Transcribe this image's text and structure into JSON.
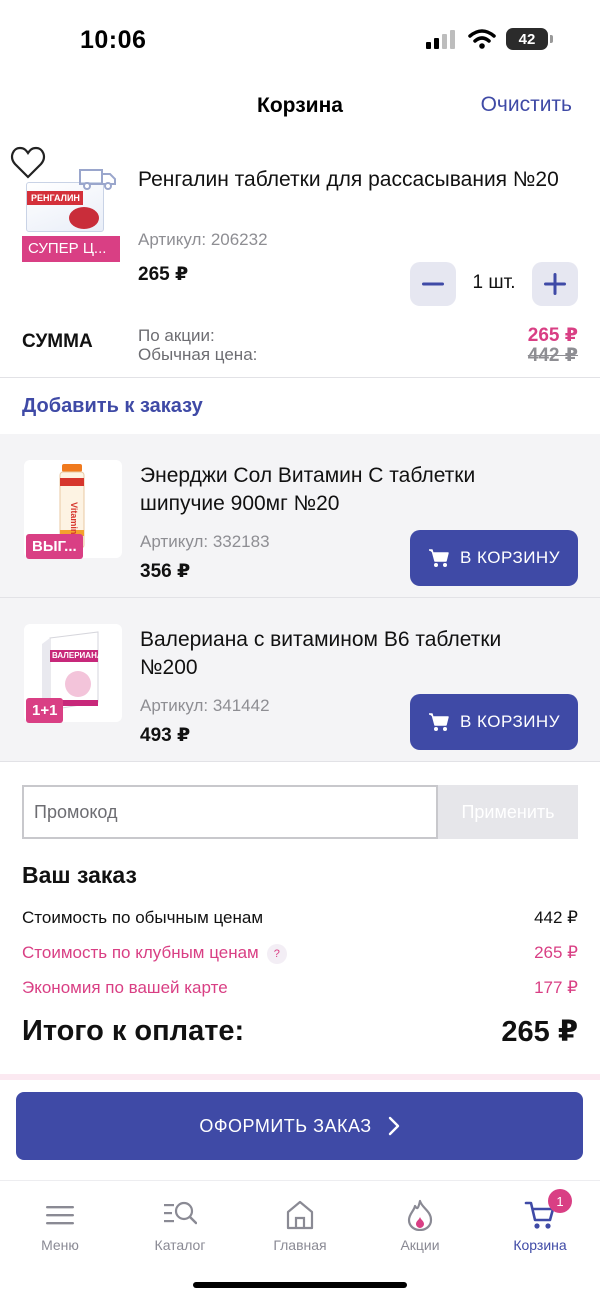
{
  "status_bar": {
    "time": "10:06",
    "battery": "42"
  },
  "header": {
    "title": "Корзина",
    "clear_label": "Очистить"
  },
  "cart_item": {
    "badge": "СУПЕР Ц...",
    "name": "Ренгалин таблетки для рассасывания №20",
    "sku": "Артикул: 206232",
    "price": "265 ₽",
    "quantity": "1 шт.",
    "sum_label": "СУММА",
    "promo_label": "По акции:",
    "regular_label": "Обычная цена:",
    "promo_value": "265 ₽",
    "regular_value": "442 ₽",
    "package_text": "РЕНГАЛИН"
  },
  "add_to_order": {
    "title": "Добавить к заказу",
    "items": [
      {
        "badge": "ВЫГ...",
        "name": "Энерджи Сол Витамин С таблетки шипучие 900мг №20",
        "sku": "Артикул: 332183",
        "price": "356 ₽",
        "button_label": "В КОРЗИНУ",
        "package_text": "Vitamin C"
      },
      {
        "badge": "1+1",
        "name": "Валериана с витамином В6 таблетки №200",
        "sku": "Артикул: 341442",
        "price": "493 ₽",
        "button_label": "В КОРЗИНУ",
        "package_text": "ВАЛЕРИАНА"
      }
    ]
  },
  "promo": {
    "placeholder": "Промокод",
    "apply_label": "Применить"
  },
  "summary": {
    "title": "Ваш заказ",
    "rows": [
      {
        "label": "Стоимость по обычным ценам",
        "value": "442 ₽"
      },
      {
        "label": "Стоимость по клубным ценам",
        "value": "265 ₽",
        "hint": "?"
      },
      {
        "label": "Экономия по вашей карте",
        "value": "177 ₽"
      }
    ],
    "total_label": "Итого к оплате:",
    "total_value": "265 ₽"
  },
  "checkout": {
    "label": "ОФОРМИТЬ ЗАКАЗ"
  },
  "tab_bar": {
    "items": [
      {
        "label": "Меню",
        "icon": "menu-icon"
      },
      {
        "label": "Каталог",
        "icon": "catalog-search-icon"
      },
      {
        "label": "Главная",
        "icon": "home-icon"
      },
      {
        "label": "Акции",
        "icon": "flame-icon"
      },
      {
        "label": "Корзина",
        "icon": "cart-icon",
        "active": true,
        "badge": "1"
      }
    ]
  },
  "colors": {
    "accent": "#3f4aa6",
    "pink": "#d93f84",
    "muted": "#8e8e93"
  }
}
